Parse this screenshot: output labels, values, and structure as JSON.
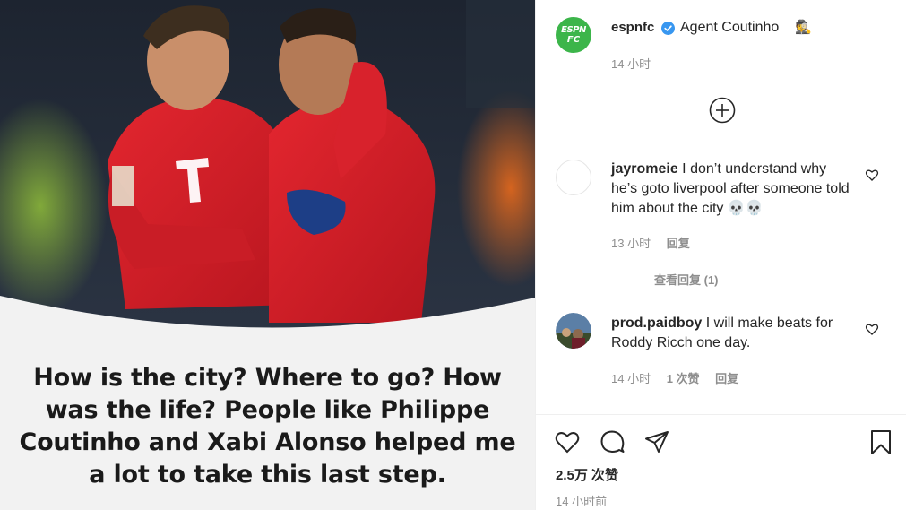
{
  "post": {
    "caption_text": "How is the city? Where to go? How was the life? People like Philippe Coutinho and Xabi Alonso helped me a lot to take this last step."
  },
  "header": {
    "username": "espnfc",
    "avatar_text_line1": "ESPN",
    "avatar_text_line2": "FC",
    "location": "Agent Coutinho",
    "location_emoji": "🕵️",
    "time": "14 小时"
  },
  "comments": [
    {
      "username": "jayromeie",
      "text": "I don’t understand why he’s goto liverpool after someone told him about the city 💀💀",
      "time": "13 小时",
      "reply_label": "回复"
    },
    {
      "username": "prod.paidboy",
      "text": "I will make beats for Roddy Ricch one day.",
      "time": "14 小时",
      "likes_label": "1 次赞",
      "reply_label": "回复"
    }
  ],
  "view_replies_label": "查看回复 (1)",
  "footer": {
    "likes": "2.5万 次赞",
    "posted_time": "14 小时前"
  },
  "icons": {
    "verified": "verified-badge-icon",
    "add": "plus-circle-icon",
    "like": "heart-icon",
    "comment": "speech-bubble-icon",
    "share": "paper-plane-icon",
    "save": "bookmark-icon"
  },
  "colors": {
    "brand_green": "#3cb54a",
    "verified_blue": "#3897f0",
    "jersey_red": "#d8222c",
    "text_secondary": "#8e8e8e"
  }
}
